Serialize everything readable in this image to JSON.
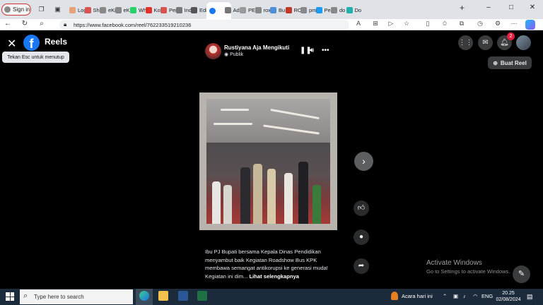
{
  "browser": {
    "signin_label": "Sign in",
    "tabs": [
      {
        "label": "Log",
        "color": "#e8a27a"
      },
      {
        "label": "Sho",
        "color": "#d9534f"
      },
      {
        "label": "eKi",
        "color": "#888888"
      },
      {
        "label": "eKi",
        "color": "#888888"
      },
      {
        "label": "Wh",
        "color": "#25d366"
      },
      {
        "label": "Ko",
        "color": "#e0312b"
      },
      {
        "label": "Per",
        "color": "#d9534f"
      },
      {
        "label": "Ind",
        "color": "#777777"
      },
      {
        "label": "Edi",
        "color": "#555555"
      },
      {
        "label": "",
        "color": "#1877f2",
        "active": true
      },
      {
        "label": "Adr",
        "color": "#777777"
      },
      {
        "label": "PEI",
        "color": "#999999"
      },
      {
        "label": "rox",
        "color": "#888888"
      },
      {
        "label": "Bu",
        "color": "#4a90d9"
      },
      {
        "label": "RO",
        "color": "#c0392b"
      },
      {
        "label": "pm",
        "color": "#888888"
      },
      {
        "label": "Per",
        "color": "#1d9bf0"
      },
      {
        "label": "do",
        "color": "#888888"
      },
      {
        "label": "Do",
        "color": "#20b2aa"
      }
    ],
    "url": "https://www.facebook.com/reel/762233519210236"
  },
  "facebook": {
    "page_title": "Reels",
    "tooltip": "Tekan Esc untuk menutup",
    "notification_count": "2",
    "create_reel_label": "Buat Reel",
    "author": {
      "name": "Rustiyana Aja Mengikuti",
      "visibility": "Publik"
    },
    "caption_text": "Ibu PJ Bupati bersama Kepala Dinas Pendidikan menyambut baik Kegiatan Roadshow Bus KPK membawa semangat antikorupsi ke generasi muda! Kegiatan ini dim...",
    "see_more_label": "Lihat selengkapnya"
  },
  "windows": {
    "activate_title": "Activate Windows",
    "activate_sub": "Go to Settings to activate Windows.",
    "search_placeholder": "Type here to search",
    "news_label": "Acara hari ini",
    "lang": "ENG",
    "time": "20.25",
    "date": "02/08/2024"
  },
  "icons": {
    "close": "close-icon",
    "menu": "grid-menu-icon",
    "messenger": "messenger-icon",
    "notifications": "bell-icon",
    "like": "thumbs-up-icon",
    "comment": "comment-icon",
    "share": "share-icon",
    "next": "chevron-right-icon",
    "pause": "pause-icon",
    "volume": "volume-icon",
    "more": "more-horizontal-icon"
  },
  "colors": {
    "fb_blue": "#1877f2",
    "badge_red": "#e41e3f",
    "taskbar": "#1c2b3b"
  }
}
